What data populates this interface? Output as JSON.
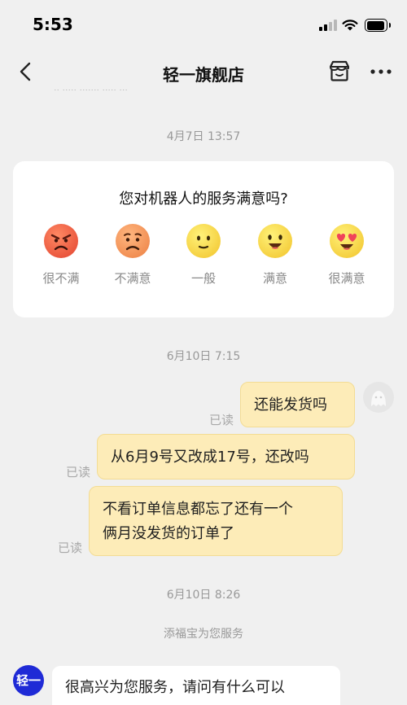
{
  "status_bar": {
    "time": "5:53"
  },
  "nav": {
    "title": "轻一旗舰店",
    "back_icon": "chevron-left-icon",
    "shop_icon": "store-icon",
    "more_icon": "more-horizontal-icon"
  },
  "top_cut_text": "·· ·····  ······· ····· ···",
  "rating": {
    "timestamp": "4月7日 13:57",
    "question": "您对机器人的服务满意吗?",
    "options": [
      {
        "label": "很不满",
        "icon": "angry-face-icon",
        "color": "#f06a4a"
      },
      {
        "label": "不满意",
        "icon": "frown-face-icon",
        "color": "#f39a60"
      },
      {
        "label": "一般",
        "icon": "neutral-face-icon",
        "color": "#f7d84f"
      },
      {
        "label": "满意",
        "icon": "smile-face-icon",
        "color": "#f7d84f"
      },
      {
        "label": "很满意",
        "icon": "heart-eyes-face-icon",
        "color": "#f7d84f"
      }
    ]
  },
  "conversation": {
    "timestamp_1": "6月10日 7:15",
    "messages": [
      {
        "text": "还能发货吗",
        "status": "已读"
      },
      {
        "text": "从6月9号又改成17号，还改吗",
        "status": "已读"
      },
      {
        "text": "不看订单信息都忘了还有一个俩月没发货的订单了",
        "line1": "不看订单信息都忘了还有一个",
        "line2": "俩月没发货的订单了",
        "status": "已读"
      }
    ],
    "timestamp_2": "6月10日 8:26",
    "service_note": "添福宝为您服务",
    "bot_avatar_text": "轻一",
    "bot_message": "很高兴为您服务，请问有什么可以"
  },
  "colors": {
    "background": "#f0f0f0",
    "outgoing_bubble": "#fdecb8",
    "bot_avatar": "#1f2ad6"
  }
}
